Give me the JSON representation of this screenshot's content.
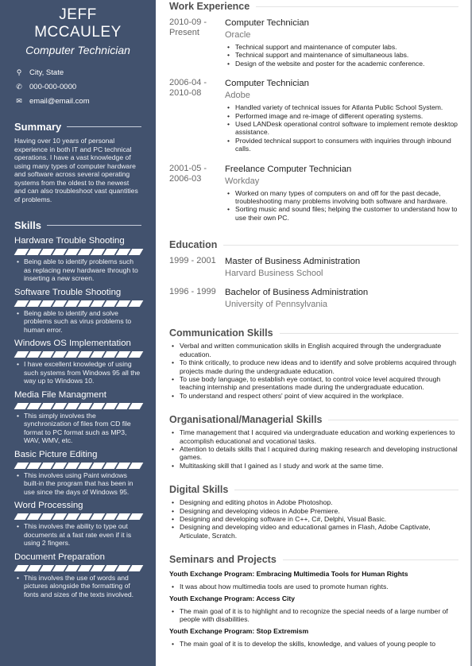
{
  "profile": {
    "name": "JEFF MCCAULEY",
    "title": "Computer Technician",
    "contacts": [
      {
        "icon": "location-pin-icon",
        "glyph": "⚲",
        "text": "City, State"
      },
      {
        "icon": "phone-icon",
        "glyph": "✆",
        "text": "000-000-0000"
      },
      {
        "icon": "envelope-icon",
        "glyph": "✉",
        "text": "email@email.com"
      }
    ]
  },
  "summary": {
    "heading": "Summary",
    "text": "Having over 10 years of personal experience in both IT and PC technical operations. I have a vast knowledge of using many types of computer hardware and software across several operating systems from the oldest to the newest and can also troubleshoot vast quantities of problems."
  },
  "skills": {
    "heading": "Skills",
    "items": [
      {
        "name": "Hardware Trouble Shooting",
        "level": 1.0,
        "desc": "Being able to identify problems such as replacing new hardware through to inserting a new screen."
      },
      {
        "name": "Software Trouble Shooting",
        "level": 1.0,
        "desc": "Being able to identify and solve problems such as virus problems to human error."
      },
      {
        "name": "Windows OS Implementation",
        "level": 1.0,
        "desc": "I have excellent knowledge of using such systems from Windows 95 all the way up to Windows 10."
      },
      {
        "name": "Media File Managment",
        "level": 1.0,
        "desc": "This simply involves the synchronization of files from CD file format to PC format such as MP3, WAV, WMV, etc."
      },
      {
        "name": "Basic Picture Editing",
        "level": 1.0,
        "desc": "This involves using Paint windows built-in the program that has been in use since the days of Windows 95."
      },
      {
        "name": "Word Processing",
        "level": 1.0,
        "desc": "This involves the ability to type out documents at a fast rate even if it is using 2 fingers."
      },
      {
        "name": "Document Preparation",
        "level": 1.0,
        "desc": "This involves the use of words and pictures alongside the formatting of fonts and sizes of the texts involved."
      }
    ]
  },
  "work": {
    "heading": "Work Experience",
    "jobs": [
      {
        "dates": "2010-09 -\nPresent",
        "title": "Computer Technician",
        "company": "Oracle",
        "bullets": [
          "Technical support and maintenance of computer labs.",
          "Technical support and maintenance of simultaneous labs.",
          "Design of the website and poster for the academic conference."
        ]
      },
      {
        "dates": "2006-04 -\n2010-08",
        "title": "Computer Technician",
        "company": "Adobe",
        "bullets": [
          "Handled variety of technical issues for Atlanta Public School System.",
          "Performed image and re-image of different operating systems.",
          "Used LANDesk operational control software to implement remote desktop assistance.",
          "Provided technical support to consumers with inquiries through inbound calls."
        ]
      },
      {
        "dates": "2001-05 -\n2006-03",
        "title": "Freelance Computer Technician",
        "company": "Workday",
        "bullets": [
          "Worked on many types of computers on and off for the past decade, troubleshooting many problems involving both software and hardware.",
          "Sorting music and sound files; helping the customer to understand how to use their own PC."
        ]
      }
    ]
  },
  "education": {
    "heading": "Education",
    "items": [
      {
        "dates": "1999 - 2001",
        "degree": "Master of Business Administration",
        "school": "Harvard Business School"
      },
      {
        "dates": "1996 - 1999",
        "degree": "Bachelor of Business Administration",
        "school": "University of Pennsylvania"
      }
    ]
  },
  "communication": {
    "heading": "Communication Skills",
    "bullets": [
      "Verbal and written communication skills in English acquired through the undergraduate education.",
      "To think critically, to produce new ideas and to identify and solve problems acquired through projects made during the undergraduate education.",
      "To use body language, to establish eye contact, to control voice level acquired through teaching internship and presentations made during the undergraduate education.",
      "To understand and respect others' point of view acquired in the workplace."
    ]
  },
  "organisational": {
    "heading": "Organisational/Managerial Skills",
    "bullets": [
      "Time management that I acquired via undergraduate education and working experiences to accomplish educational and vocational tasks.",
      "Attention to details skills that I acquired during making research and developing instructional games.",
      "Multitasking skill that I gained as I study and work at the same time."
    ]
  },
  "digital": {
    "heading": "Digital Skills",
    "bullets": [
      "Designing and editing photos in Adobe Photoshop.",
      "Designing and developing videos in Adobe Premiere.",
      "Designing and developing software in C++, C#, Delphi, Visual Basic.",
      "Designing and developing video and educational games in Flash, Adobe Captivate, Articulate, Scratch."
    ]
  },
  "seminars": {
    "heading": "Seminars and Projects",
    "items": [
      {
        "title": "Youth Exchange Program: Embracing Multimedia Tools for Human Rights",
        "bullets": [
          "It was about how multimedia tools are used to promote human rights."
        ]
      },
      {
        "title": "Youth Exchange Program: Access City",
        "bullets": [
          "The main goal of it is to highlight and to recognize the special needs of a large number of people with disabilities."
        ]
      },
      {
        "title": "Youth Exchange Program: Stop Extremism",
        "bullets": [
          "The main goal of it is to develop the skills, knowledge, and values of young people to"
        ]
      }
    ]
  },
  "colors": {
    "sidebar_bg": "#42526e",
    "heading_text": "#505050",
    "muted_text": "#777777"
  }
}
